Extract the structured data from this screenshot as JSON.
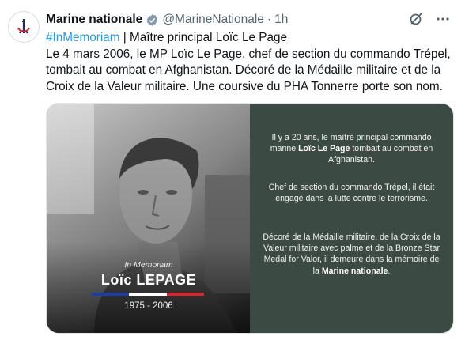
{
  "account": {
    "name": "Marine nationale",
    "handle": "@MarineNationale",
    "separator": "·",
    "time": "1h"
  },
  "tweet": {
    "hashtag": "#InMemoriam",
    "title_rest": " | Maître principal Loïc Le Page",
    "text": "Le 4 mars 2006, le MP Loïc Le Page, chef de section du commando Trépel, tombait au combat en Afghanistan.  Décoré de la Médaille militaire et de la Croix de la Valeur militaire.  Une coursive du PHA Tonnerre porte son nom."
  },
  "media": {
    "photo": {
      "label": "In Memoriam",
      "name": "Loïc LEPAGE",
      "years": "1975 - 2006",
      "flag_colors": [
        "#1f3fa0",
        "#ffffff",
        "#d8262e"
      ]
    },
    "panel": {
      "p1_a": "Il y a 20 ans, le maître principal commando marine ",
      "p1_bold": "Loïc Le Page",
      "p1_b": " tombait au combat en Afghanistan.",
      "p2": "Chef de section du commando Trépel, il était engagé dans la lutte contre le terrorisme.",
      "p3_a": "Décoré de la Médaille militaire, de la Croix de la Valeur militaire avec palme et de la Bronze Star Medal for Valor, il demeure dans la mémoire de la ",
      "p3_bold": "Marine nationale",
      "p3_b": "."
    }
  },
  "icons": [
    "marine-nationale-logo",
    "verified-badge-icon",
    "grok-icon",
    "more-icon"
  ],
  "colors": {
    "link": "#1d9bf0",
    "panel_bg": "#3c4a44",
    "muted": "#536471"
  }
}
